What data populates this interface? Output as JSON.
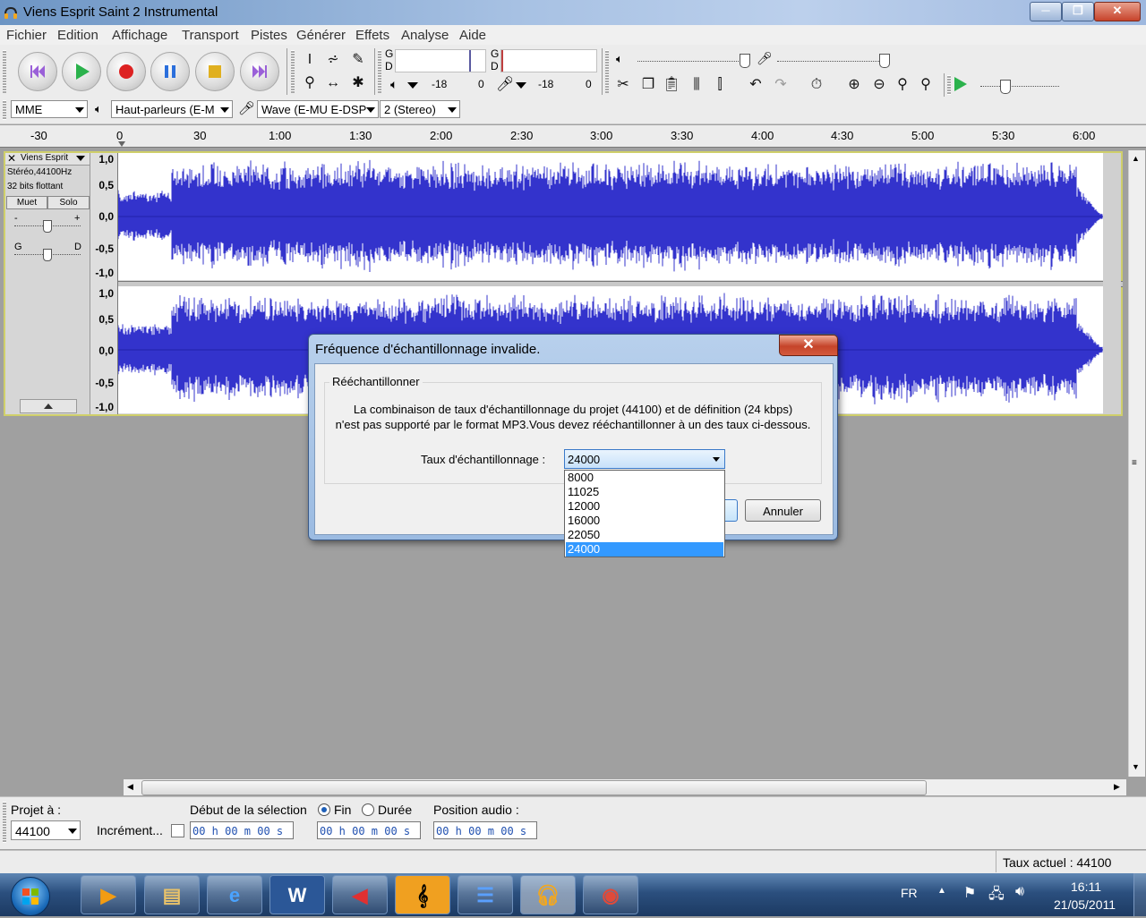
{
  "window": {
    "title": "Viens Esprit Saint 2  Instrumental",
    "minimize": "─",
    "maximize": "❐",
    "close": "✕"
  },
  "menu": [
    "Fichier",
    "Edition",
    "Affichage",
    "Transport",
    "Pistes",
    "Générer",
    "Effets",
    "Analyse",
    "Aide"
  ],
  "meters": {
    "play_channels": [
      "G",
      "D"
    ],
    "rec_channels": [
      "G",
      "D"
    ],
    "play_db": "-18",
    "play_zero": "0",
    "rec_db": "-18",
    "rec_zero": "0"
  },
  "devices": {
    "host": "MME",
    "output": "Haut-parleurs (E-M",
    "input": "Wave (E-MU E-DSP",
    "channels": "2 (Stereo)"
  },
  "ruler": [
    "-30",
    "0",
    "30",
    "1:00",
    "1:30",
    "2:00",
    "2:30",
    "3:00",
    "3:30",
    "4:00",
    "4:30",
    "5:00",
    "5:30",
    "6:00"
  ],
  "track": {
    "name": "Viens Esprit",
    "format": "Stéréo,44100Hz",
    "depth": "32 bits flottant",
    "mute": "Muet",
    "solo": "Solo",
    "gain_minus": "-",
    "gain_plus": "+",
    "pan_left": "G",
    "pan_right": "D",
    "scale": [
      "1,0",
      "0,5",
      "0,0",
      "-0,5",
      "-1,0"
    ],
    "wave_color": "#3333cc"
  },
  "dialog": {
    "title": "Fréquence d'échantillonnage invalide.",
    "close": "✕",
    "group": "Rééchantillonner",
    "line1": "La combinaison de taux d'échantillonnage du projet (44100) et de définition  (24 kbps)",
    "line2": "n'est pas supporté par le format MP3.Vous devez rééchantillonner à un des taux ci-dessous.",
    "rate_label": "Taux d'échantillonnage :",
    "rate_value": "24000",
    "options": [
      "8000",
      "11025",
      "12000",
      "16000",
      "22050",
      "24000"
    ],
    "cancel": "Annuler"
  },
  "selection": {
    "project_label": "Projet à :",
    "project_rate": "44100",
    "increment": "Incrément...",
    "start_label": "Début de la sélection",
    "end_label": "Fin",
    "duration_label": "Durée",
    "position_label": "Position audio :",
    "time_start": "00 h 00 m 00 s",
    "time_end": "00 h 00 m 00 s",
    "time_pos": "00 h 00 m 00 s"
  },
  "status": {
    "rate": "Taux actuel : 44100"
  },
  "taskbar": {
    "lang": "FR",
    "time": "16:11",
    "date": "21/05/2011"
  },
  "colors": {
    "accent_select": "#3399ff",
    "track_border": "#cfcf6a"
  }
}
